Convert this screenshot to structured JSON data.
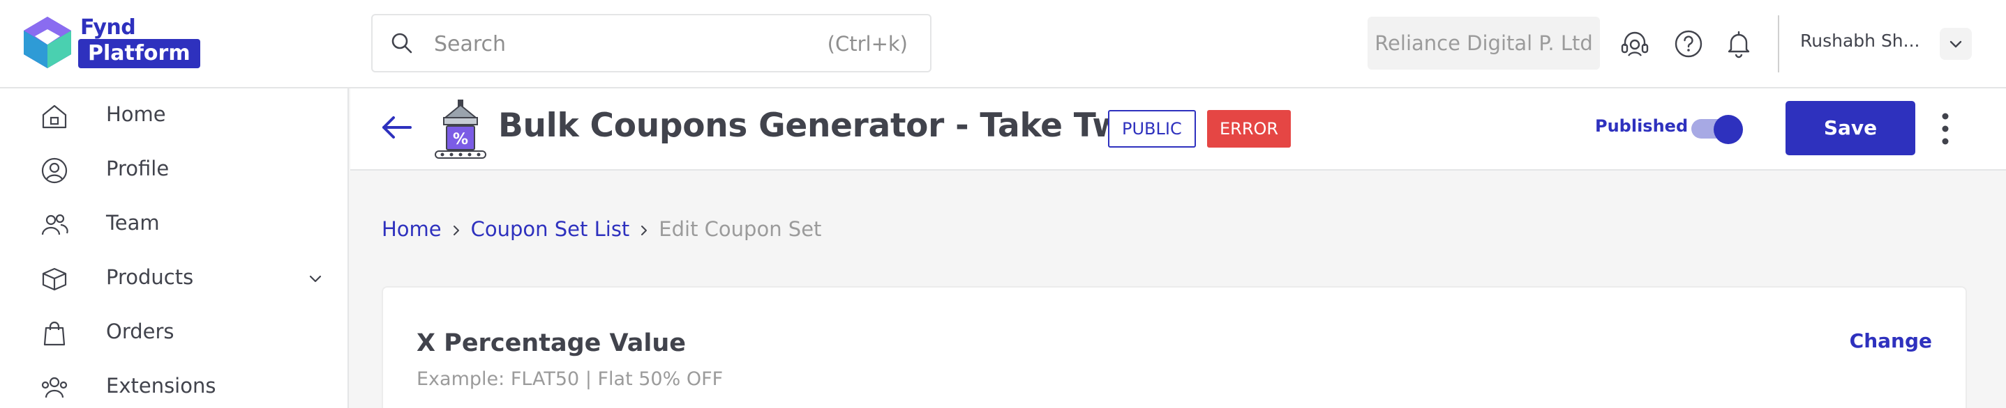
{
  "brand": {
    "top_word": "Fynd",
    "pill_word": "Platform",
    "accent": "#2e31be"
  },
  "search": {
    "placeholder": "Search",
    "shortcut": "(Ctrl+k)",
    "icon": "search-icon"
  },
  "company": {
    "name": "Reliance Digital P. Ltd"
  },
  "top_icons": [
    "headset-support-icon",
    "help-circle-icon",
    "bell-icon"
  ],
  "user": {
    "name": "Rushabh Sh...",
    "icon": "chevron-down-icon"
  },
  "sidebar": {
    "items": [
      {
        "label": "Home",
        "icon": "home-icon"
      },
      {
        "label": "Profile",
        "icon": "user-circle-icon"
      },
      {
        "label": "Team",
        "icon": "team-icon"
      },
      {
        "label": "Products",
        "icon": "box-icon",
        "expandable": true
      },
      {
        "label": "Orders",
        "icon": "shopping-bag-icon"
      },
      {
        "label": "Extensions",
        "icon": "users-icon"
      }
    ]
  },
  "header": {
    "title": "Bulk Coupons Generator - Take Two",
    "badge_public": "PUBLIC",
    "badge_error": "ERROR",
    "published_label": "Published",
    "published": true,
    "save_label": "Save",
    "error_color": "#e54644"
  },
  "breadcrumb": {
    "home": "Home",
    "list": "Coupon Set List",
    "current": "Edit Coupon Set"
  },
  "card": {
    "title": "X Percentage Value",
    "example": "Example: FLAT50 | Flat 50% OFF",
    "action": "Change"
  }
}
